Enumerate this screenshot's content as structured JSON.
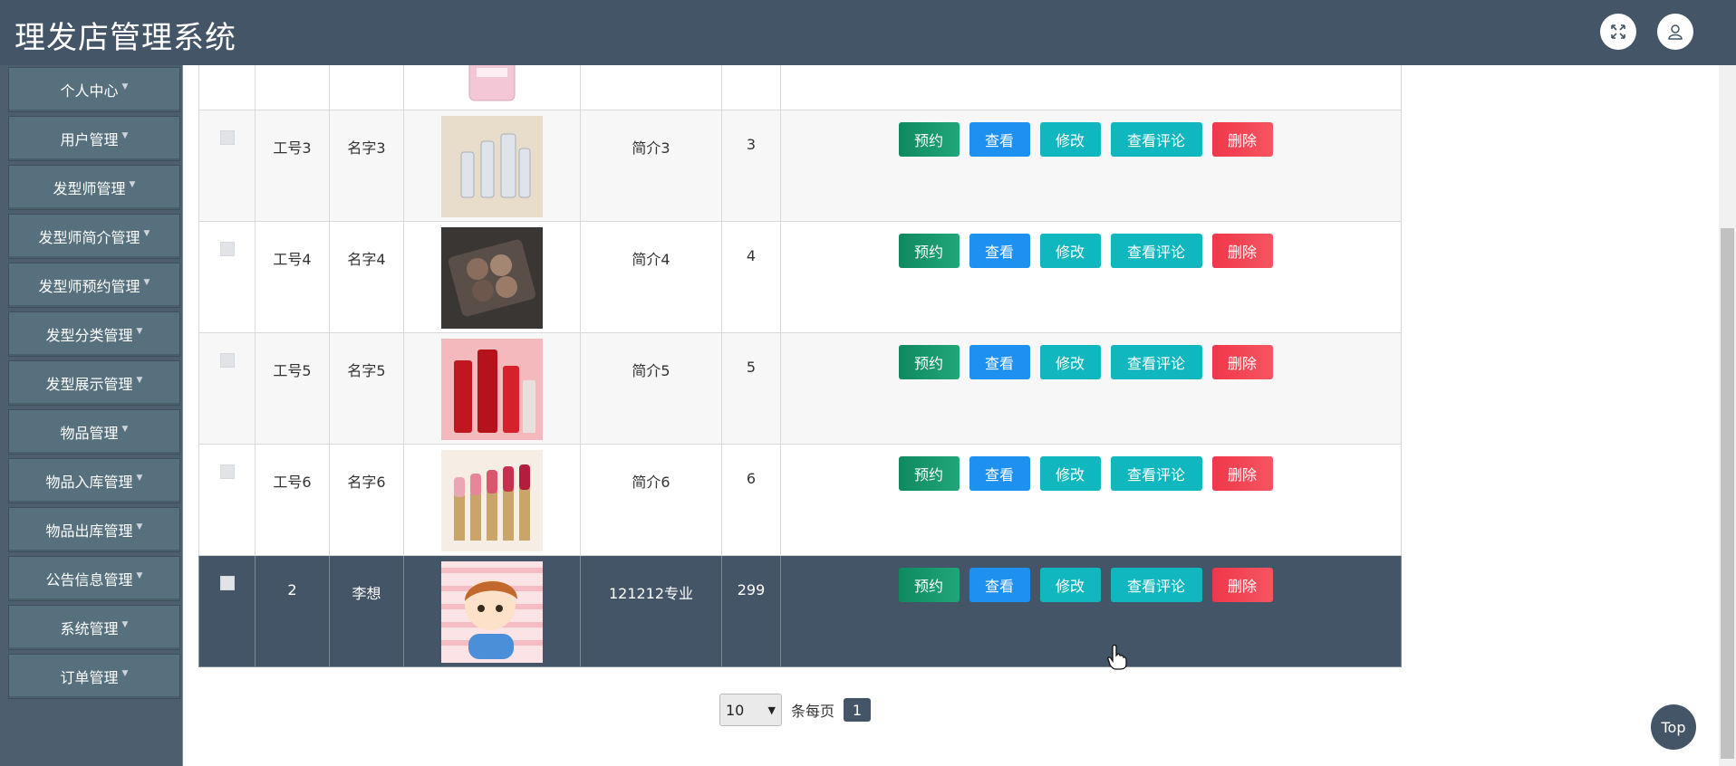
{
  "app": {
    "title": "理发店管理系统"
  },
  "header": {
    "fullscreen_icon": "expand-icon",
    "user_icon": "user-icon"
  },
  "sidebar": {
    "items": [
      {
        "label": "个人中心"
      },
      {
        "label": "用户管理"
      },
      {
        "label": "发型师管理"
      },
      {
        "label": "发型师简介管理"
      },
      {
        "label": "发型师预约管理"
      },
      {
        "label": "发型分类管理"
      },
      {
        "label": "发型展示管理"
      },
      {
        "label": "物品管理"
      },
      {
        "label": "物品入库管理"
      },
      {
        "label": "物品出库管理"
      },
      {
        "label": "公告信息管理"
      },
      {
        "label": "系统管理"
      },
      {
        "label": "订单管理"
      }
    ]
  },
  "actions": {
    "book": "预约",
    "view": "查看",
    "edit": "修改",
    "comments": "查看评论",
    "delete": "删除"
  },
  "table": {
    "rows": [
      {
        "id": "工号3",
        "name": "名字3",
        "image": "skincare-bottles-image",
        "intro": "简介3",
        "num": "3"
      },
      {
        "id": "工号4",
        "name": "名字4",
        "image": "eyeshadow-palette-image",
        "intro": "简介4",
        "num": "4"
      },
      {
        "id": "工号5",
        "name": "名字5",
        "image": "red-cosmetics-image",
        "intro": "简介5",
        "num": "5"
      },
      {
        "id": "工号6",
        "name": "名字6",
        "image": "lipsticks-image",
        "intro": "简介6",
        "num": "6"
      },
      {
        "id": "2",
        "name": "李想",
        "image": "cartoon-avatar-image",
        "intro": "121212专业",
        "num": "299"
      }
    ]
  },
  "pagination": {
    "page_size": "10",
    "per_page_label": "条每页",
    "current_page": "1"
  },
  "top_button": {
    "label": "Top"
  },
  "colors": {
    "header": "#435566",
    "sidebar": "#4d5f6f",
    "book": "#1a9a6c",
    "view": "#1e90ef",
    "edit": "#11b7bf",
    "delete": "#f0374a"
  }
}
